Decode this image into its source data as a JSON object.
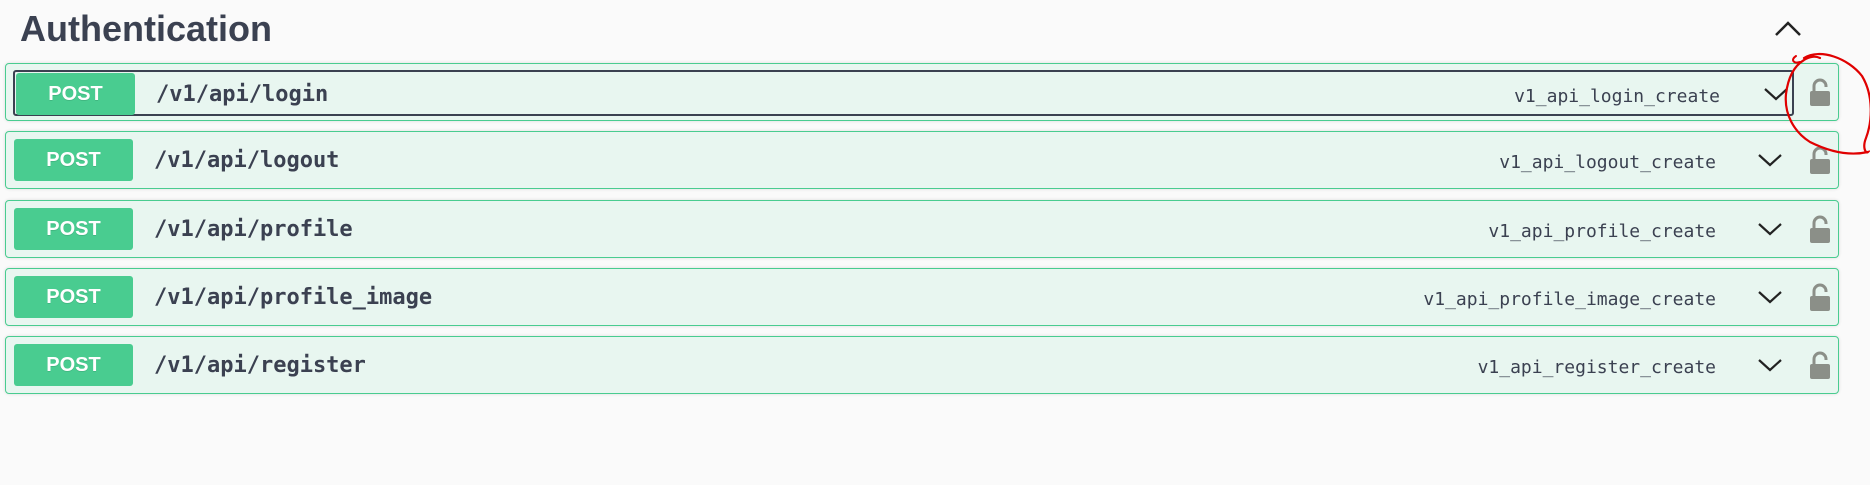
{
  "section": {
    "title": "Authentication",
    "collapse_icon": "chevron-up-icon"
  },
  "operations": [
    {
      "method": "POST",
      "path": "/v1/api/login",
      "operation_id": "v1_api_login_create",
      "focused": true
    },
    {
      "method": "POST",
      "path": "/v1/api/logout",
      "operation_id": "v1_api_logout_create",
      "focused": false
    },
    {
      "method": "POST",
      "path": "/v1/api/profile",
      "operation_id": "v1_api_profile_create",
      "focused": false
    },
    {
      "method": "POST",
      "path": "/v1/api/profile_image",
      "operation_id": "v1_api_profile_image_create",
      "focused": false
    },
    {
      "method": "POST",
      "path": "/v1/api/register",
      "operation_id": "v1_api_register_create",
      "focused": false
    }
  ],
  "icons": {
    "expand": "chevron-down-icon",
    "authorization": "unlocked-padlock-icon"
  },
  "colors": {
    "post_method": "#49cc90",
    "post_background": "#e8f6f0",
    "text": "#3b4151",
    "lock": "#8b8f88",
    "annotation": "#e00000"
  }
}
